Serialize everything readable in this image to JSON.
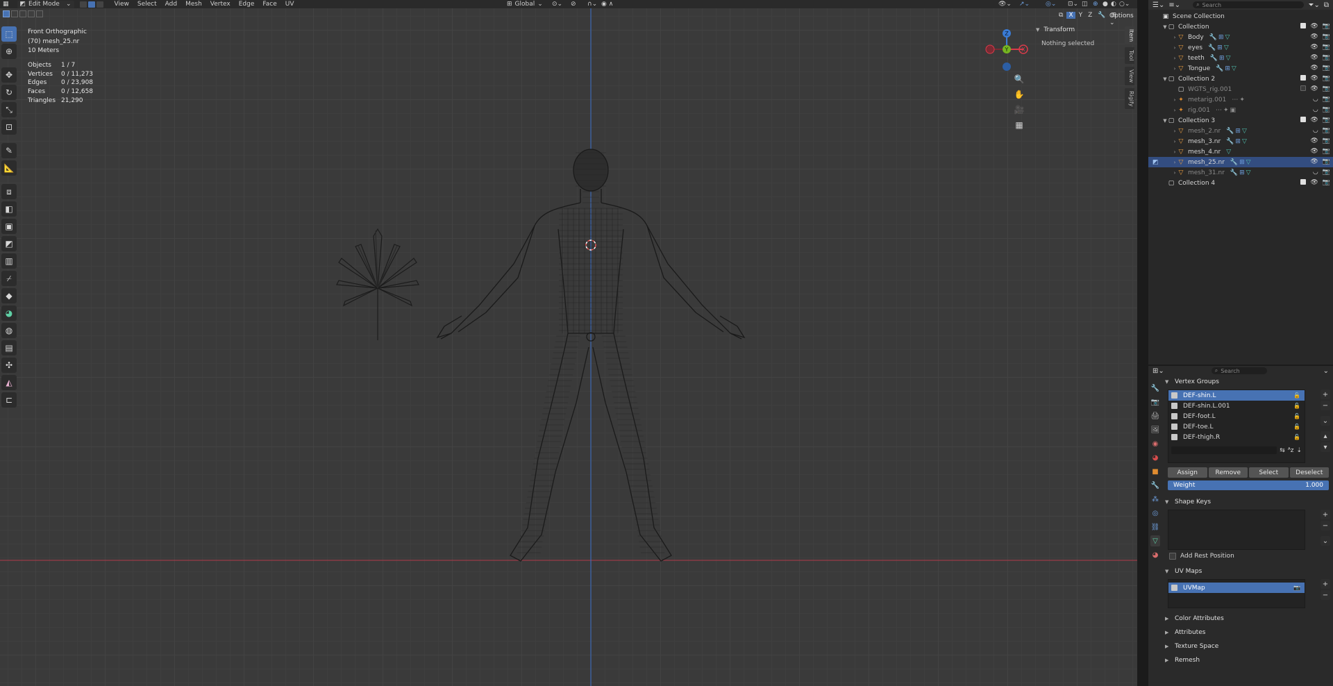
{
  "header": {
    "mode": "Edit Mode",
    "menus": [
      "View",
      "Select",
      "Add",
      "Mesh",
      "Vertex",
      "Edge",
      "Face",
      "UV"
    ],
    "transform_orientation": "Global",
    "options_label": "Options",
    "search_placeholder": "Search"
  },
  "viewport": {
    "view_name": "Front Orthographic",
    "object_name": "(70) mesh_25.nr",
    "scale": "10 Meters",
    "stats": [
      {
        "label": "Objects",
        "value": "1 / 7"
      },
      {
        "label": "Vertices",
        "value": "0 / 11,273"
      },
      {
        "label": "Edges",
        "value": "0 / 23,908"
      },
      {
        "label": "Faces",
        "value": "0 / 12,658"
      },
      {
        "label": "Triangles",
        "value": "21,290"
      }
    ],
    "gizmo": {
      "x": "X",
      "y": "Y",
      "z": "Z"
    },
    "axis_colors": {
      "x": "#d93b4a",
      "y": "#76b521",
      "z": "#3a7bd5"
    },
    "tabs": [
      "Item",
      "Tool",
      "View",
      "Rigify"
    ],
    "sidebar": {
      "panel": "Transform",
      "message": "Nothing selected"
    }
  },
  "outliner": {
    "search_placeholder": "Search",
    "root": "Scene Collection",
    "rows": [
      {
        "label": "Collection",
        "type": "collection",
        "depth": 1
      },
      {
        "label": "Body",
        "type": "mesh",
        "depth": 2
      },
      {
        "label": "eyes",
        "type": "mesh",
        "depth": 2
      },
      {
        "label": "teeth",
        "type": "mesh",
        "depth": 2
      },
      {
        "label": "Tongue",
        "type": "mesh",
        "depth": 2
      },
      {
        "label": "Collection 2",
        "type": "collection",
        "depth": 1
      },
      {
        "label": "WGTS_rig.001",
        "type": "collection",
        "depth": 2
      },
      {
        "label": "metarig.001",
        "type": "armature",
        "depth": 2
      },
      {
        "label": "rig.001",
        "type": "armature",
        "depth": 2
      },
      {
        "label": "Collection 3",
        "type": "collection",
        "depth": 1
      },
      {
        "label": "mesh_2.nr",
        "type": "mesh",
        "depth": 2
      },
      {
        "label": "mesh_3.nr",
        "type": "mesh",
        "depth": 2
      },
      {
        "label": "mesh_4.nr",
        "type": "mesh",
        "depth": 2
      },
      {
        "label": "mesh_25.nr",
        "type": "mesh",
        "depth": 2
      },
      {
        "label": "mesh_31.nr",
        "type": "mesh",
        "depth": 2
      },
      {
        "label": "Collection 4",
        "type": "collection",
        "depth": 1
      }
    ]
  },
  "properties": {
    "search_placeholder": "Search",
    "vertex_groups": {
      "title": "Vertex Groups",
      "items": [
        "DEF-shin.L",
        "DEF-shin.L.001",
        "DEF-foot.L",
        "DEF-toe.L",
        "DEF-thigh.R"
      ],
      "assign": "Assign",
      "remove": "Remove",
      "select": "Select",
      "deselect": "Deselect",
      "weight_label": "Weight",
      "weight_value": "1.000"
    },
    "shape_keys": {
      "title": "Shape Keys",
      "add_rest": "Add Rest Position"
    },
    "uv_maps": {
      "title": "UV Maps",
      "items": [
        "UVMap"
      ]
    },
    "collapsed_panels": [
      "Color Attributes",
      "Attributes",
      "Texture Space",
      "Remesh"
    ]
  }
}
